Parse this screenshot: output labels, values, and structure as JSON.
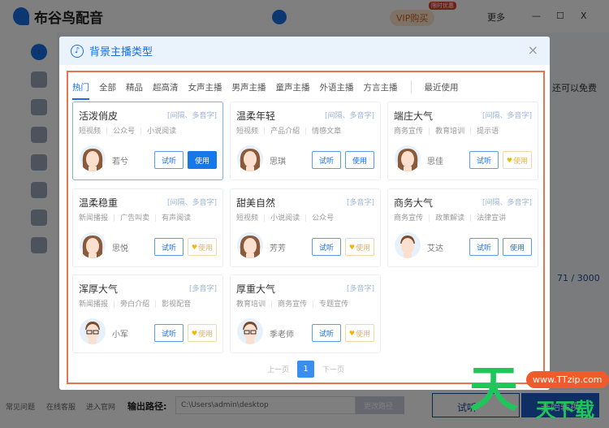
{
  "app": {
    "name": "布谷鸟配音",
    "vip": "VIP购买",
    "vip_badge": "限时优惠",
    "more": "更多",
    "minimize": "—",
    "maximize": "☐",
    "close": "X"
  },
  "right_pane": {
    "free_hint": "还可以免费",
    "counter": "71 / 3000"
  },
  "bottom": {
    "faq": "常见问题",
    "service": "在线客服",
    "website": "进入官网",
    "output_label": "输出路径:",
    "output_path": "C:\\Users\\admin\\desktop",
    "change_path": "更改路径",
    "listen": "试听",
    "start": "开始转换"
  },
  "modal": {
    "title": "背景主播类型",
    "close": "×",
    "tabs": [
      "热门",
      "全部",
      "精品",
      "超高清",
      "女声主播",
      "男声主播",
      "童声主播",
      "外语主播",
      "方言主播"
    ],
    "recent": "最近使用",
    "cards": [
      {
        "title": "活泼俏皮",
        "tag": "[间隔、多音字]",
        "uses": [
          "短视频",
          "公众号",
          "小说阅读"
        ],
        "name": "若兮",
        "listen": "试听",
        "use": "使用",
        "use_type": "primary",
        "gender": "f"
      },
      {
        "title": "温柔年轻",
        "tag": "[间隔、多音字]",
        "uses": [
          "短视频",
          "产品介绍",
          "情感文章"
        ],
        "name": "思琪",
        "listen": "试听",
        "use": "使用",
        "use_type": "normal",
        "gender": "f"
      },
      {
        "title": "端庄大气",
        "tag": "[间隔、多音字]",
        "uses": [
          "商务宣传",
          "教育培训",
          "提示语"
        ],
        "name": "思佳",
        "listen": "试听",
        "use": "使用",
        "use_type": "vip",
        "gender": "f"
      },
      {
        "title": "温柔稳重",
        "tag": "[间隔、多音字]",
        "uses": [
          "新闻播报",
          "广告叫卖",
          "有声阅读"
        ],
        "name": "思悦",
        "listen": "试听",
        "use": "使用",
        "use_type": "vip",
        "gender": "f"
      },
      {
        "title": "甜美自然",
        "tag": "[多音字]",
        "uses": [
          "短视频",
          "小说阅读",
          "公众号"
        ],
        "name": "芳芳",
        "listen": "试听",
        "use": "使用",
        "use_type": "vip",
        "gender": "f"
      },
      {
        "title": "商务大气",
        "tag": "[间隔、多音字]",
        "uses": [
          "商务宣传",
          "政策解读",
          "法律宣讲"
        ],
        "name": "艾达",
        "listen": "试听",
        "use": "使用",
        "use_type": "normal",
        "gender": "m"
      },
      {
        "title": "浑厚大气",
        "tag": "[多音字]",
        "uses": [
          "新闻播报",
          "旁白介绍",
          "影视配音"
        ],
        "name": "小军",
        "listen": "试听",
        "use": "使用",
        "use_type": "vip",
        "gender": "m"
      },
      {
        "title": "厚重大气",
        "tag": "[多音字]",
        "uses": [
          "教育培训",
          "商务宣传",
          "专题宣传"
        ],
        "name": "季老师",
        "listen": "试听",
        "use": "使用",
        "use_type": "vip",
        "gender": "m"
      }
    ],
    "pager": {
      "prev": "上一页",
      "current": "1",
      "next": "下一页"
    }
  },
  "watermark": {
    "big": "天",
    "url": "www.TTzip.com",
    "small": "天下载"
  }
}
